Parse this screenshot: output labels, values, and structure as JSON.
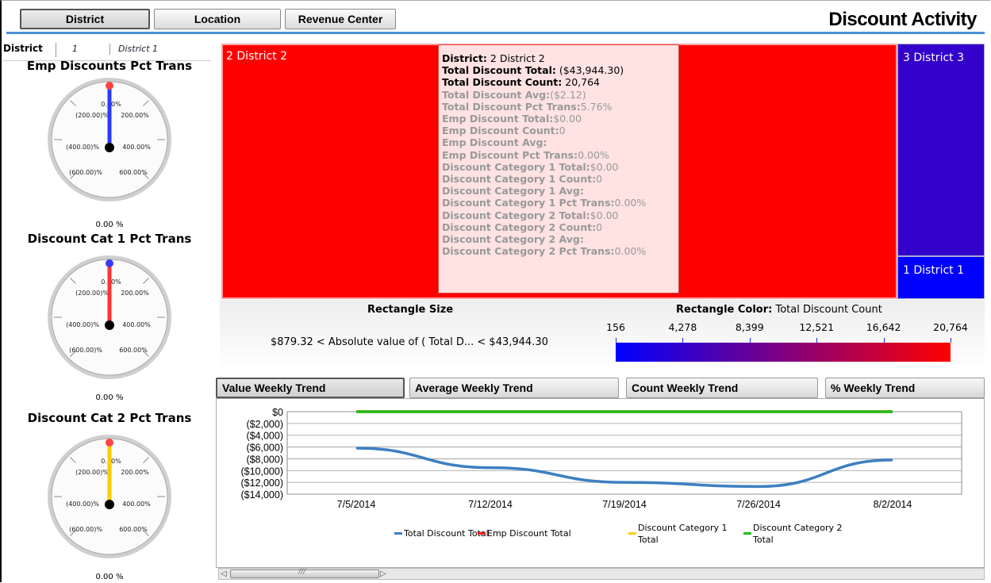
{
  "tabs": [
    {
      "label": "District"
    },
    {
      "label": "Location"
    },
    {
      "label": "Revenue Center"
    }
  ],
  "title": "Discount Activity",
  "breadcrumb": {
    "label": "District",
    "level": "1",
    "value": "District 1"
  },
  "gauges": [
    {
      "title": "Emp Discounts Pct Trans",
      "value_text": "0.00 %",
      "needle_color": "#2a3bff",
      "cap_color": "#ff4444",
      "value_fraction": 0
    },
    {
      "title": "Discount Cat 1 Pct Trans",
      "value_text": "0.00 %",
      "needle_color": "#ff3333",
      "cap_color": "#3a3aff",
      "value_fraction": 0
    },
    {
      "title": "Discount Cat 2 Pct Trans",
      "value_text": "0.00 %",
      "needle_color": "#ffcc00",
      "cap_color": "#ff4444",
      "value_fraction": 0
    }
  ],
  "gauge_ticks": {
    "top": "0.00%",
    "ul": "(200.00)%",
    "ur": "200.00%",
    "ml": "(400.00)%",
    "mr": "400.00%",
    "ll": "(600.00)%",
    "lr": "600.00%"
  },
  "treemap": {
    "cells": [
      {
        "label": "2 District 2",
        "color": "#ff0000"
      },
      {
        "label": "3 District 3",
        "color": "#3300cc"
      },
      {
        "label": "1 District 1",
        "color": "#0000ff"
      }
    ]
  },
  "tooltip": {
    "lines": [
      {
        "key": "District:",
        "val": " 2 District 2",
        "tone": "b"
      },
      {
        "key": "Total Discount Total:",
        "val": " ($43,944.30)",
        "tone": "b"
      },
      {
        "key": "Total Discount Count:",
        "val": " 20,764",
        "tone": "b"
      },
      {
        "key": "Total Discount Avg:",
        "val": "($2.12)",
        "tone": "g"
      },
      {
        "key": "Total Discount Pct Trans:",
        "val": "5.76%",
        "tone": "g"
      },
      {
        "key": "Emp Discount Total:",
        "val": "$0.00",
        "tone": "g"
      },
      {
        "key": "Emp Discount Count:",
        "val": "0",
        "tone": "g"
      },
      {
        "key": "Emp Discount Avg:",
        "val": "",
        "tone": "g"
      },
      {
        "key": "Emp Discount Pct Trans:",
        "val": "0.00%",
        "tone": "g"
      },
      {
        "key": "Discount Category 1 Total:",
        "val": "$0.00",
        "tone": "g"
      },
      {
        "key": "Discount Category 1 Count:",
        "val": "0",
        "tone": "g"
      },
      {
        "key": "Discount Category 1 Avg:",
        "val": "",
        "tone": "g"
      },
      {
        "key": "Discount Category 1 Pct Trans:",
        "val": "0.00%",
        "tone": "g"
      },
      {
        "key": "Discount Category 2 Total:",
        "val": "$0.00",
        "tone": "g"
      },
      {
        "key": "Discount Category 2 Count:",
        "val": "0",
        "tone": "g"
      },
      {
        "key": "Discount Category 2 Avg:",
        "val": "",
        "tone": "g"
      },
      {
        "key": "Discount Category 2 Pct Trans:",
        "val": "0.00%",
        "tone": "g"
      }
    ]
  },
  "legend": {
    "size_title": "Rectangle Size",
    "size_text": "$879.32 < Absolute value of ( Total D... < $43,944.30",
    "color_title": "Rectangle Color:",
    "color_measure": " Total Discount Count",
    "color_ticks": [
      "156",
      "4,278",
      "8,399",
      "12,521",
      "16,642",
      "20,764"
    ],
    "gradient_start": "#0000ff",
    "gradient_end": "#ff0000"
  },
  "trend_tabs": [
    {
      "label": "Value Weekly Trend"
    },
    {
      "label": "Average Weekly Trend"
    },
    {
      "label": "Count Weekly Trend"
    },
    {
      "label": "% Weekly Trend"
    }
  ],
  "chart_data": {
    "type": "line",
    "x": [
      "7/5/2014",
      "7/12/2014",
      "7/19/2014",
      "7/26/2014",
      "8/2/2014"
    ],
    "ylim": [
      -14000,
      0
    ],
    "y_ticks": [
      "$0",
      "($2,000)",
      "($4,000)",
      "($6,000)",
      "($8,000)",
      "($10,000)",
      "($12,000)",
      "($14,000)"
    ],
    "series": [
      {
        "name": "Total Discount Total",
        "color": "#3e7fc1",
        "values": [
          -6200,
          -9500,
          -12000,
          -12700,
          -8200
        ]
      },
      {
        "name": "Emp Discount Total",
        "color": "#ff2222",
        "values": [
          0,
          0,
          0,
          0,
          0
        ]
      },
      {
        "name": "Discount Category 1 Total",
        "color": "#ffcc00",
        "values": [
          0,
          0,
          0,
          0,
          0
        ]
      },
      {
        "name": "Discount Category 2 Total",
        "color": "#22bb22",
        "values": [
          0,
          0,
          0,
          0,
          0
        ]
      }
    ],
    "legend_placement": "bottom",
    "grid": true
  }
}
